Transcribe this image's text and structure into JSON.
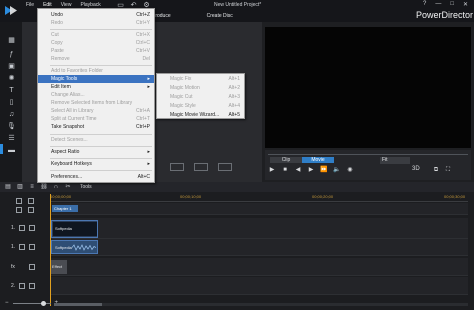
{
  "window": {
    "title": "New Untitled Project*",
    "brand": "PowerDirector",
    "controls": [
      "?",
      "—",
      "□",
      "✕"
    ]
  },
  "menubar": [
    "File",
    "Edit",
    "View",
    "Playback"
  ],
  "tabs": [
    "Produce",
    "Create Disc"
  ],
  "edit_menu": [
    {
      "label": "Undo",
      "shortcut": "Ctrl+Z",
      "enabled": true
    },
    {
      "label": "Redo",
      "shortcut": "Ctrl+Y",
      "enabled": false
    },
    {
      "label": "Cut",
      "shortcut": "Ctrl+X",
      "enabled": false
    },
    {
      "label": "Copy",
      "shortcut": "Ctrl+C",
      "enabled": false
    },
    {
      "label": "Paste",
      "shortcut": "Ctrl+V",
      "enabled": false
    },
    {
      "label": "Remove",
      "shortcut": "Del",
      "enabled": false
    },
    {
      "label": "Add to Favorites Folder",
      "shortcut": "",
      "enabled": false
    },
    {
      "label": "Magic Tools",
      "shortcut": "▸",
      "enabled": true,
      "highlighted": true
    },
    {
      "label": "Edit Item",
      "shortcut": "▸",
      "enabled": true
    },
    {
      "label": "Change Alias...",
      "shortcut": "",
      "enabled": false
    },
    {
      "label": "Remove Selected Items from Library",
      "shortcut": "",
      "enabled": false
    },
    {
      "label": "Select All in Library",
      "shortcut": "Ctrl+A",
      "enabled": false
    },
    {
      "label": "Split at Current Time",
      "shortcut": "Ctrl+T",
      "enabled": false
    },
    {
      "label": "Take Snapshot",
      "shortcut": "Ctrl+P",
      "enabled": true
    },
    {
      "label": "Detect Scenes...",
      "shortcut": "",
      "enabled": false
    },
    {
      "label": "Aspect Ratio",
      "shortcut": "▸",
      "enabled": true
    },
    {
      "label": "Keyboard Hotkeys",
      "shortcut": "▸",
      "enabled": true
    },
    {
      "label": "Preferences...",
      "shortcut": "Alt+C",
      "enabled": true
    }
  ],
  "magic_submenu": [
    {
      "label": "Magic Fix",
      "shortcut": "Alt+1",
      "enabled": false
    },
    {
      "label": "Magic Motion",
      "shortcut": "Alt+2",
      "enabled": false
    },
    {
      "label": "Magic Cut",
      "shortcut": "Alt+3",
      "enabled": false
    },
    {
      "label": "Magic Style",
      "shortcut": "Alt+4",
      "enabled": false
    },
    {
      "label": "Magic Movie Wizard...",
      "shortcut": "Alt+5",
      "enabled": true
    }
  ],
  "preview": {
    "mode_clip": "Clip",
    "mode_movie": "Movie",
    "fit": "Fit",
    "threed": "3D"
  },
  "timeline": {
    "tools_label": "Tools",
    "ruler": [
      "00;00;00;00",
      "00;00;10;00",
      "00;00;20;00",
      "00;00;30;00"
    ],
    "chapter": "Chapter 1",
    "track_labels": [
      "1.",
      "1.",
      "fx",
      "2."
    ],
    "video_clip": "Softpedia",
    "audio_clip": "Softpedia",
    "fx_clip": "Effect"
  },
  "colors": {
    "accent": "#2f7ec7",
    "menu_highlight": "#3b73c1",
    "playhead": "#e0a020"
  }
}
